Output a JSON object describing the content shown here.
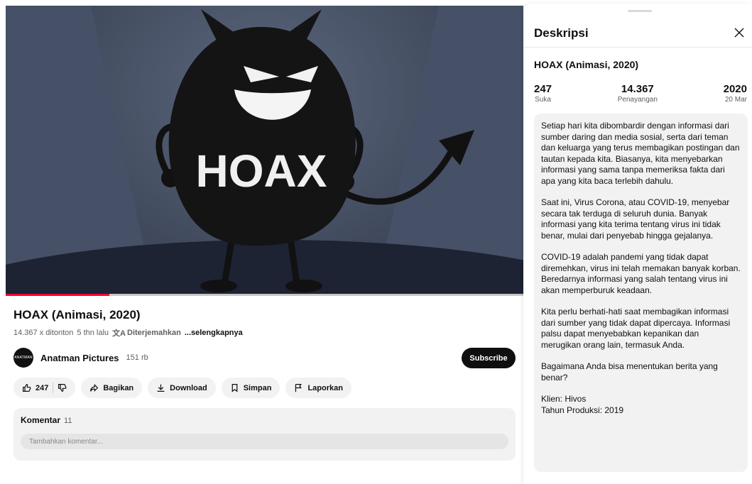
{
  "video": {
    "thumbnail_text": "HOAX",
    "progress_percent": 20
  },
  "title": "HOAX (Animasi, 2020)",
  "meta": {
    "views": "14.367 x ditonton",
    "age": "5 thn lalu",
    "translated": "Diterjemahkan",
    "more": "...selengkapnya"
  },
  "channel": {
    "avatar_text": "ANATMAN",
    "name": "Anatman Pictures",
    "subscribers": "151 rb",
    "subscribe_label": "Subscribe"
  },
  "actions": {
    "like_count": "247",
    "share": "Bagikan",
    "download": "Download",
    "save": "Simpan",
    "report": "Laporkan"
  },
  "comments": {
    "label": "Komentar",
    "count": "11",
    "placeholder": "Tambahkan komentar..."
  },
  "panel": {
    "title": "Deskripsi",
    "video_title": "HOAX (Animasi, 2020)",
    "stats": [
      {
        "value": "247",
        "label": "Suka"
      },
      {
        "value": "14.367",
        "label": "Penayangan"
      },
      {
        "value": "2020",
        "label": "20 Mar"
      }
    ],
    "paragraphs": [
      "Setiap hari kita dibombardir dengan informasi dari sumber daring dan media sosial, serta dari teman dan keluarga yang terus membagikan postingan dan tautan kepada kita. Biasanya, kita menyebarkan informasi yang sama tanpa memeriksa fakta dari apa yang kita baca terlebih dahulu.",
      "Saat ini, Virus Corona, atau COVID-19, menyebar secara tak terduga di seluruh dunia. Banyak informasi yang kita terima tentang virus ini tidak benar, mulai dari penyebab hingga gejalanya.",
      "COVID-19 adalah pandemi yang tidak dapat diremehkan, virus ini telah memakan banyak korban. Beredarnya informasi yang salah tentang virus ini akan memperburuk keadaan.",
      "Kita perlu berhati-hati saat membagikan informasi dari sumber yang tidak dapat dipercaya. Informasi palsu dapat menyebabkan kepanikan dan merugikan orang lain, termasuk Anda.",
      "Bagaimana Anda bisa menentukan berita yang benar?"
    ],
    "client": "Klien: Hivos",
    "production_year": "Tahun Produksi: 2019"
  }
}
